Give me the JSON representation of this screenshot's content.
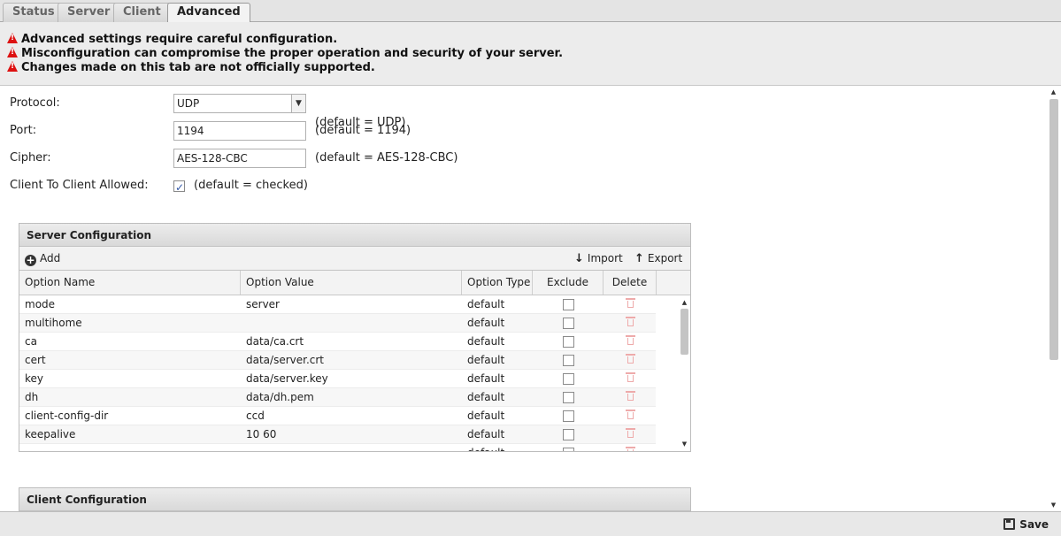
{
  "tabs": [
    "Status",
    "Server",
    "Client",
    "Advanced"
  ],
  "warnings": [
    "Advanced settings require careful configuration.",
    "Misconfiguration can compromise the proper operation and security of your server.",
    "Changes made on this tab are not officially supported."
  ],
  "form": {
    "protocol": {
      "label": "Protocol:",
      "value": "UDP",
      "hint": "(default = UDP)"
    },
    "port": {
      "label": "Port:",
      "value": "1194",
      "hint": "(default = 1194)"
    },
    "cipher": {
      "label": "Cipher:",
      "value": "AES-128-CBC",
      "hint": "(default = AES-128-CBC)"
    },
    "client_to_client": {
      "label": "Client To Client Allowed:",
      "checked": true,
      "hint": "(default = checked)"
    }
  },
  "server_config": {
    "title": "Server Configuration",
    "add_label": "Add",
    "import_label": "Import",
    "export_label": "Export",
    "columns": [
      "Option Name",
      "Option Value",
      "Option Type",
      "Exclude",
      "Delete"
    ],
    "rows": [
      {
        "name": "mode",
        "value": "server",
        "type": "default"
      },
      {
        "name": "multihome",
        "value": "",
        "type": "default"
      },
      {
        "name": "ca",
        "value": "data/ca.crt",
        "type": "default"
      },
      {
        "name": "cert",
        "value": "data/server.crt",
        "type": "default"
      },
      {
        "name": "key",
        "value": "data/server.key",
        "type": "default"
      },
      {
        "name": "dh",
        "value": "data/dh.pem",
        "type": "default"
      },
      {
        "name": "client-config-dir",
        "value": "ccd",
        "type": "default"
      },
      {
        "name": "keepalive",
        "value": "10 60",
        "type": "default"
      },
      {
        "name": "",
        "value": "",
        "type": "default"
      }
    ]
  },
  "client_config": {
    "title": "Client Configuration"
  },
  "footer": {
    "save_label": "Save"
  }
}
